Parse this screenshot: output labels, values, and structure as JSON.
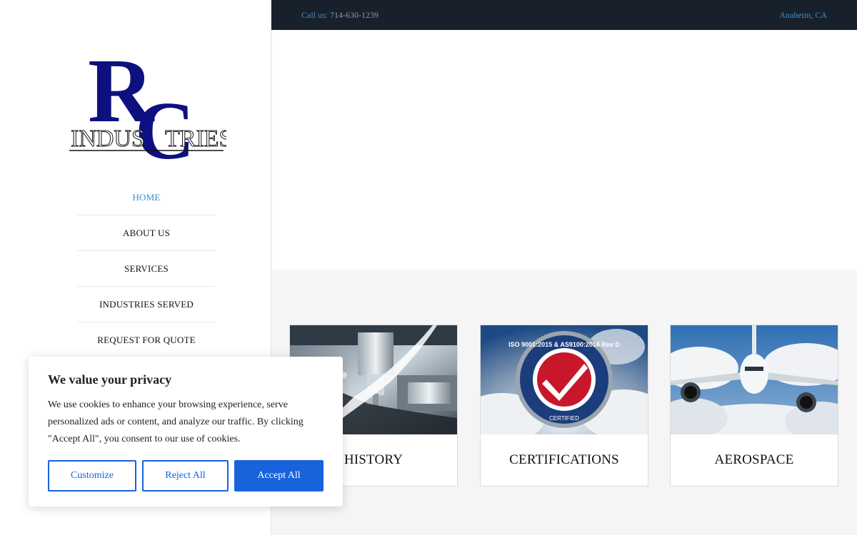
{
  "brand": {
    "logo_text": "INDUSTRIES",
    "monogram": "RC",
    "primary_color": "#0e1080"
  },
  "topbar": {
    "call_label": "Call us:",
    "phone": "714-630-1239",
    "location": "Anaheim, CA",
    "link_color": "#3a8fc4"
  },
  "nav": {
    "items": [
      {
        "label": "HOME"
      },
      {
        "label": "ABOUT US"
      },
      {
        "label": "SERVICES"
      },
      {
        "label": "INDUSTRIES SERVED"
      },
      {
        "label": "REQUEST FOR QUOTE"
      }
    ]
  },
  "cards": [
    {
      "label": "HISTORY",
      "image": "cnc-milling-machine-image"
    },
    {
      "label": "CERTIFICATIONS",
      "image": "iso-certified-seal-image",
      "seal_text": "ISO 9001:2015 & AS9100:2016 Rev D",
      "seal_sub": "CERTIFIED"
    },
    {
      "label": "AEROSPACE",
      "image": "airplane-clouds-image"
    }
  ],
  "cookie": {
    "title": "We value your privacy",
    "body": "We use cookies to enhance your browsing experience, serve personalized ads or content, and analyze our traffic. By clicking \"Accept All\", you consent to our use of cookies.",
    "customize_label": "Customize",
    "reject_label": "Reject All",
    "accept_label": "Accept All",
    "accent_color": "#1863dc"
  }
}
